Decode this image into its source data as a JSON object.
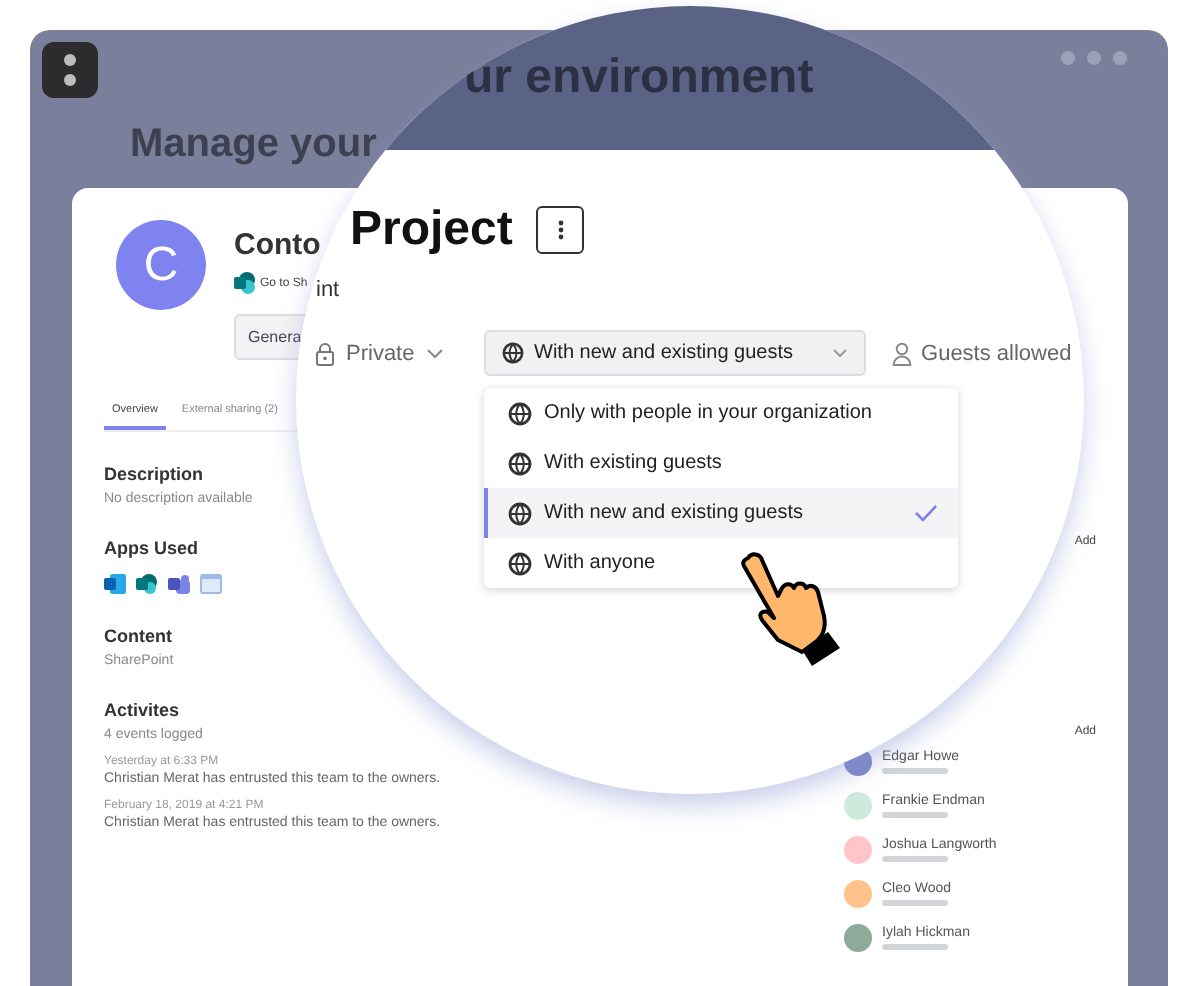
{
  "window": {
    "title": "Manage your"
  },
  "team": {
    "avatar_letter": "C",
    "name": "Conto",
    "site_link": "Go to Sh",
    "button": "Genera"
  },
  "tabs": [
    {
      "label": "Overview",
      "selected": true
    },
    {
      "label": "External sharing (2)",
      "selected": false
    }
  ],
  "sections": [
    {
      "kind": "text",
      "title": "Description",
      "text": "No description available"
    },
    {
      "kind": "apps",
      "title": "Apps Used"
    },
    {
      "kind": "text",
      "title": "Content",
      "text": "SharePoint"
    },
    {
      "kind": "activity",
      "title": "Activites",
      "text": "4 events logged",
      "events": [
        {
          "time": "Yesterday at 6:33 PM",
          "text": "Christian Merat has entrusted this team to the owners."
        },
        {
          "time": "February 18, 2019 at 4:21 PM",
          "text": "Christian Merat has entrusted this team to the owners."
        }
      ]
    }
  ],
  "side": {
    "add_labels": [
      "Add",
      "Add"
    ],
    "members": [
      {
        "name": "Edgar Howe",
        "color": "#7b86c6"
      },
      {
        "name": "Frankie Endman",
        "color": "#cfe9dc"
      },
      {
        "name": "Joshua Langworth",
        "color": "#ffc5c9"
      },
      {
        "name": "Cleo Wood",
        "color": "#ffc28a"
      },
      {
        "name": "Iylah Hickman",
        "color": "#8faa9a"
      }
    ]
  },
  "magnifier": {
    "heading": "ur environment",
    "title": "Project",
    "link_tail": "int",
    "privacy": "Private",
    "sharing": "With new and existing guests",
    "guests": "Guests allowed",
    "options": [
      {
        "label": "Only with people in your organization",
        "selected": false
      },
      {
        "label": "With existing guests",
        "selected": false
      },
      {
        "label": "With new and existing guests",
        "selected": true
      },
      {
        "label": "With anyone",
        "selected": false
      }
    ]
  }
}
